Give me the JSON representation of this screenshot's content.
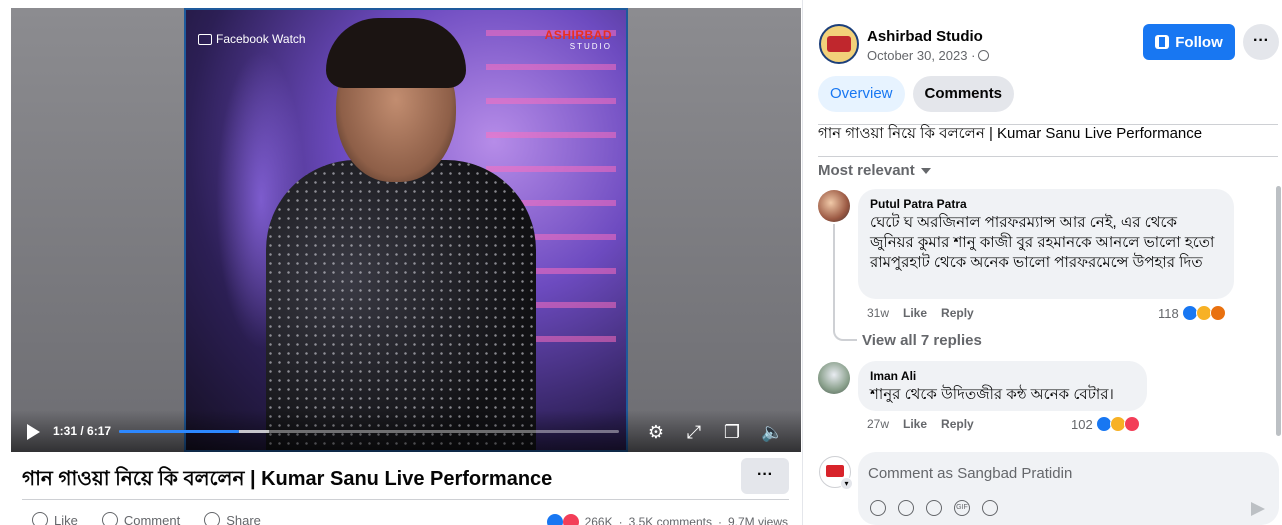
{
  "video": {
    "watermark_left": "Facebook Watch",
    "watermark_right_line1": "ASHIRBAD",
    "watermark_right_line2": "STUDIO",
    "time": "1:31 / 6:17",
    "progress_fraction": 0.24,
    "buffered_fraction": 0.3,
    "title": "গান গাওয়া নিয়ে কি বললেন | Kumar Sanu Live Performance",
    "more": "···"
  },
  "actions": {
    "like": "Like",
    "comment": "Comment",
    "share": "Share",
    "reactions_count": "266K",
    "comments_count": "3.5K comments",
    "views_count": "9.7M views"
  },
  "page": {
    "name": "Ashirbad Studio",
    "date": "October 30, 2023 ·",
    "follow": "Follow",
    "more": "···"
  },
  "tabs": {
    "overview": "Overview",
    "comments": "Comments"
  },
  "post_text": "গান গাওয়া নিয়ে কি বললেন | Kumar Sanu Live Performance",
  "sort_label": "Most relevant",
  "comments": [
    {
      "author": "Putul Patra Patra",
      "text": "ঘেটে ঘ অরজিনাল পারফরম্যান্স আর নেই, এর থেকে জুনিয়র কুমার শানু কাজী বুর রহমানকে আনলে ভালো হতো রামপুরহাট থেকে অনেক ভালো পারফরমেন্সে উপহার দিত",
      "time": "31w",
      "like": "Like",
      "reply": "Reply",
      "reactions": "118"
    },
    {
      "author": "Iman Ali",
      "text": "শানুর থেকে উদিতজীর কন্ঠ অনেক বেটার।",
      "time": "27w",
      "like": "Like",
      "reply": "Reply",
      "reactions": "102"
    }
  ],
  "view_replies": "View all 7 replies",
  "composer": {
    "placeholder": "Comment as Sangbad Pratidin"
  },
  "colors": {
    "accent": "#1877f2",
    "bubble": "#f0f2f5",
    "secondary_text": "#65676b"
  }
}
